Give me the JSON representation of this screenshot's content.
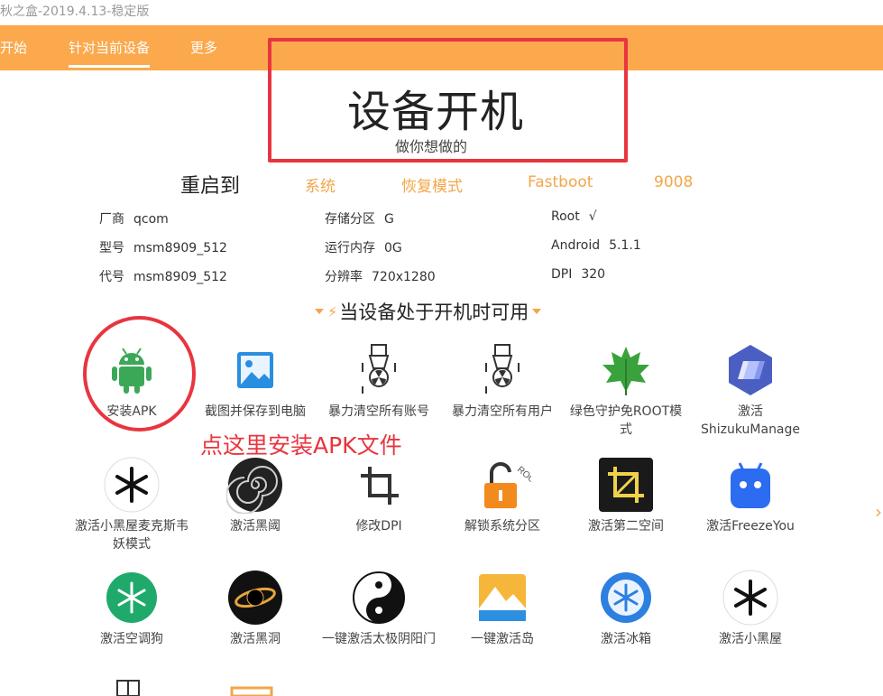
{
  "window": {
    "title": "秋之盒-2019.4.13-稳定版"
  },
  "nav": {
    "items": [
      "开始",
      "针对当前设备",
      "更多"
    ]
  },
  "hero": {
    "title": "设备开机",
    "subtitle": "做你想做的"
  },
  "reboot": {
    "label": "重启到",
    "options": [
      "系统",
      "恢复模式",
      "Fastboot",
      "9008"
    ]
  },
  "device": {
    "vendor": {
      "k": "厂商",
      "v": "qcom"
    },
    "model": {
      "k": "型号",
      "v": "msm8909_512"
    },
    "codename": {
      "k": "代号",
      "v": "msm8909_512"
    },
    "storage": {
      "k": "存储分区",
      "v": "G"
    },
    "ram": {
      "k": "运行内存",
      "v": "0G"
    },
    "resolution": {
      "k": "分辨率",
      "v": "720x1280"
    },
    "root": {
      "k": "Root",
      "v": "√"
    },
    "android": {
      "k": "Android",
      "v": "5.1.1"
    },
    "dpi": {
      "k": "DPI",
      "v": "320"
    }
  },
  "section": {
    "title": "当设备处于开机时可用"
  },
  "tiles": [
    {
      "label": "安装APK",
      "icon": "android-icon"
    },
    {
      "label": "截图并保存到电脑",
      "icon": "image-icon"
    },
    {
      "label": "暴力清空所有账号",
      "icon": "bomb-icon"
    },
    {
      "label": "暴力清空所有用户",
      "icon": "bomb-icon"
    },
    {
      "label": "绿色守护免ROOT模式",
      "icon": "leaf-icon"
    },
    {
      "label": "激活ShizukuManage",
      "icon": "shizuku-icon"
    },
    {
      "label": "激活小黑屋麦克斯韦妖模式",
      "icon": "snowflake-icon"
    },
    {
      "label": "激活黑阈",
      "icon": "spiral-icon"
    },
    {
      "label": "修改DPI",
      "icon": "crop-icon"
    },
    {
      "label": "解锁系统分区",
      "icon": "unlock-icon"
    },
    {
      "label": "激活第二空间",
      "icon": "crop-square-icon"
    },
    {
      "label": "激活FreezeYou",
      "icon": "robot-icon"
    },
    {
      "label": "激活空调狗",
      "icon": "snowflake-green-icon"
    },
    {
      "label": "激活黑洞",
      "icon": "blackhole-icon"
    },
    {
      "label": "一键激活太极阴阳门",
      "icon": "taiji-icon"
    },
    {
      "label": "一键激活岛",
      "icon": "island-icon"
    },
    {
      "label": "激活冰箱",
      "icon": "fridge-icon"
    },
    {
      "label": "激活小黑屋",
      "icon": "snowflake-icon"
    }
  ],
  "annotation": {
    "note": "点这里安装APK文件"
  },
  "colors": {
    "accent": "#fba94c",
    "highlight": "#e8353f"
  }
}
